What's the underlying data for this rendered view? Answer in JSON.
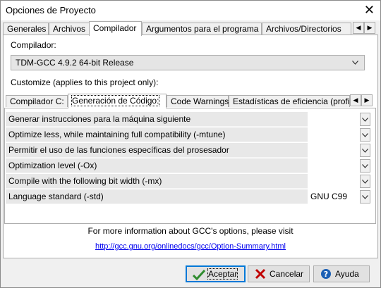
{
  "window": {
    "title": "Opciones de Proyecto"
  },
  "tabs": [
    {
      "label": "Generales",
      "active": false
    },
    {
      "label": "Archivos",
      "active": false
    },
    {
      "label": "Compilador",
      "active": true
    },
    {
      "label": "Argumentos para el programa",
      "active": false
    },
    {
      "label": "Archivos/Directorios",
      "active": false
    }
  ],
  "compiler": {
    "label": "Compilador:",
    "selected": "TDM-GCC 4.9.2 64-bit Release",
    "customize_label": "Customize (applies to this project only):"
  },
  "subtabs": [
    {
      "label": "Compilador C:",
      "active": false
    },
    {
      "label": "Generación de Código:",
      "active": true
    },
    {
      "label": "Code Warnings",
      "active": false
    },
    {
      "label": "Estadísticas de eficiencia (profil",
      "active": false
    }
  ],
  "options": [
    {
      "name": "Generar instrucciones para la máquina siguiente",
      "value": ""
    },
    {
      "name": "Optimize less, while maintaining full compatibility (-mtune)",
      "value": ""
    },
    {
      "name": "Permitir el uso de las funciones específicas del prosesador",
      "value": ""
    },
    {
      "name": "Optimization level (-Ox)",
      "value": ""
    },
    {
      "name": "Compile with the following bit width (-mx)",
      "value": ""
    },
    {
      "name": "Language standard (-std)",
      "value": "GNU C99"
    }
  ],
  "info": {
    "text": "For more information about GCC's options, please visit",
    "link": "http://gcc.gnu.org/onlinedocs/gcc/Option-Summary.html"
  },
  "buttons": {
    "accept": "Aceptar",
    "cancel": "Cancelar",
    "help": "Ayuda"
  },
  "colors": {
    "accent": "#0078d7",
    "link": "#0000ee",
    "accept_icon": "#2e8b2e",
    "cancel_icon": "#c00000",
    "help_icon": "#1a5fb4"
  }
}
